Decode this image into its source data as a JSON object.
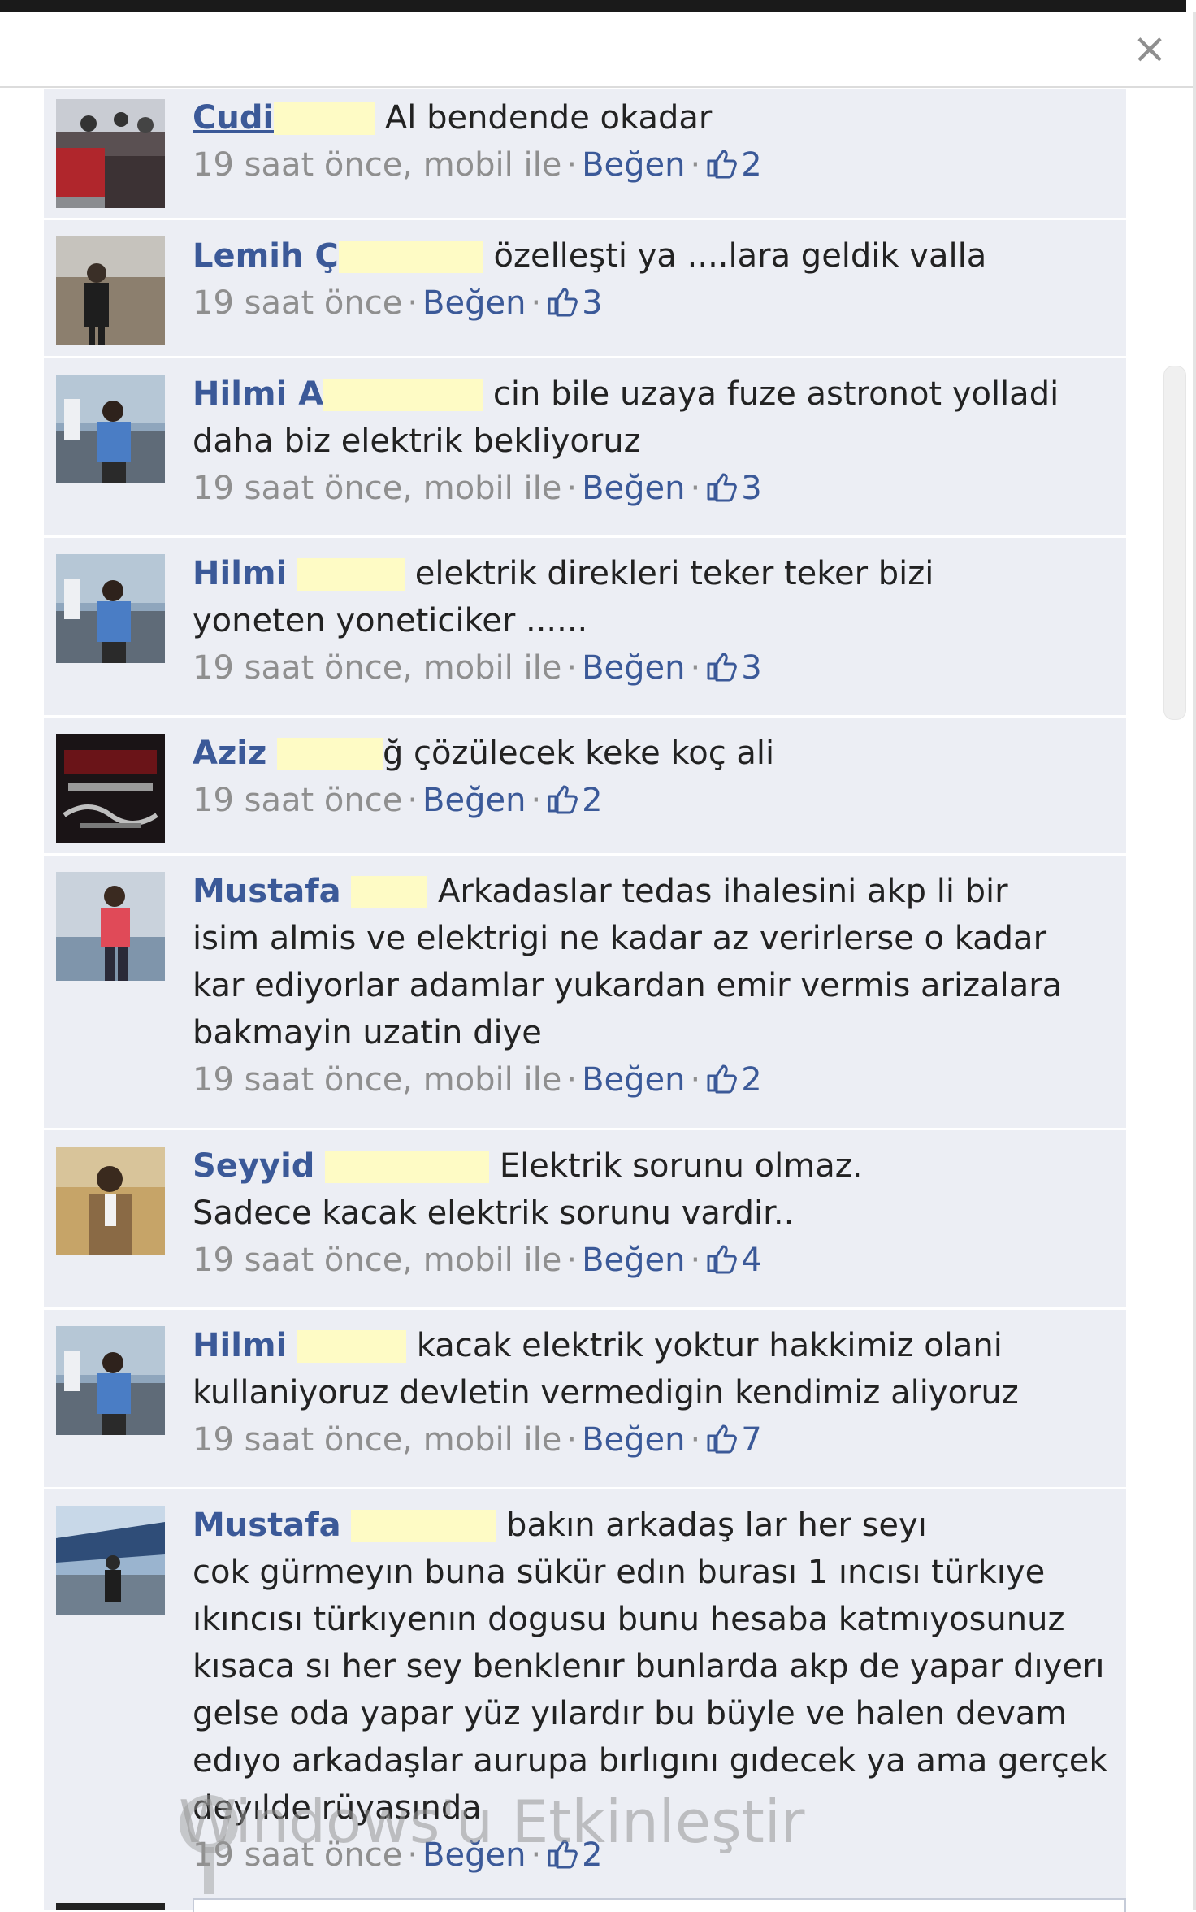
{
  "dialog": {
    "close_label": "×"
  },
  "watermark": "Windows'u Etkinleştir",
  "comments": [
    {
      "author": "Cudi",
      "text": "Al bendende okadar",
      "time": "19 saat önce, mobil ile",
      "like": "Beğen",
      "count": "2"
    },
    {
      "author": "Lemih Ç",
      "text": "özelleşti ya ....lara geldik valla",
      "time": "19 saat önce",
      "like": "Beğen",
      "count": "3"
    },
    {
      "author": "Hilmi A",
      "text": "cin bile uzaya fuze astronot yolladi",
      "text2": "daha biz elektrik bekliyoruz",
      "time": "19 saat önce, mobil ile",
      "like": "Beğen",
      "count": "3"
    },
    {
      "author": "Hilmi",
      "text": "elektrik direkleri teker teker bizi",
      "text2": "yoneten yoneticiker ......",
      "time": "19 saat önce, mobil ile",
      "like": "Beğen",
      "count": "3"
    },
    {
      "author": "Aziz",
      "text": "ğ çözülecek keke koç ali",
      "time": "19 saat önce",
      "like": "Beğen",
      "count": "2"
    },
    {
      "author": "Mustafa",
      "text": "Arkadaslar tedas ihalesini akp li bir",
      "text2": "isim almis ve elektrigi ne kadar az verirlerse o kadar",
      "text3": "kar ediyorlar adamlar yukardan emir vermis arizalara",
      "text4": "bakmayin uzatin diye",
      "time": "19 saat önce, mobil ile",
      "like": "Beğen",
      "count": "2"
    },
    {
      "author": "Seyyid",
      "text": "Elektrik sorunu olmaz.",
      "text2": "Sadece kacak elektrik sorunu vardir..",
      "time": "19 saat önce, mobil ile",
      "like": "Beğen",
      "count": "4"
    },
    {
      "author": "Hilmi",
      "text": "kacak elektrik yoktur hakkimiz olani",
      "text2": "kullaniyoruz devletin vermedigin kendimiz aliyoruz",
      "time": "19 saat önce, mobil ile",
      "like": "Beğen",
      "count": "7"
    },
    {
      "author": "Mustafa",
      "text": "bakın arkadaş lar her seyı",
      "text2": "cok gürmeyın buna sükür edın burası 1 ıncısı türkıye",
      "text3": "ıkıncısı türkıyenın dogusu bunu hesaba katmıyosunuz",
      "text4": "kısaca sı her sey benklenır bunlarda akp de yapar dıyerı",
      "text5": "gelse oda yapar yüz yılardır bu büyle ve halen devam",
      "text6": "edıyo arkadaşlar aurupa bırlıgını gıdecek ya ama gerçek",
      "text7": "deyılde rüyasında",
      "time": "19 saat önce",
      "like": "Beğen",
      "count": "2"
    }
  ]
}
